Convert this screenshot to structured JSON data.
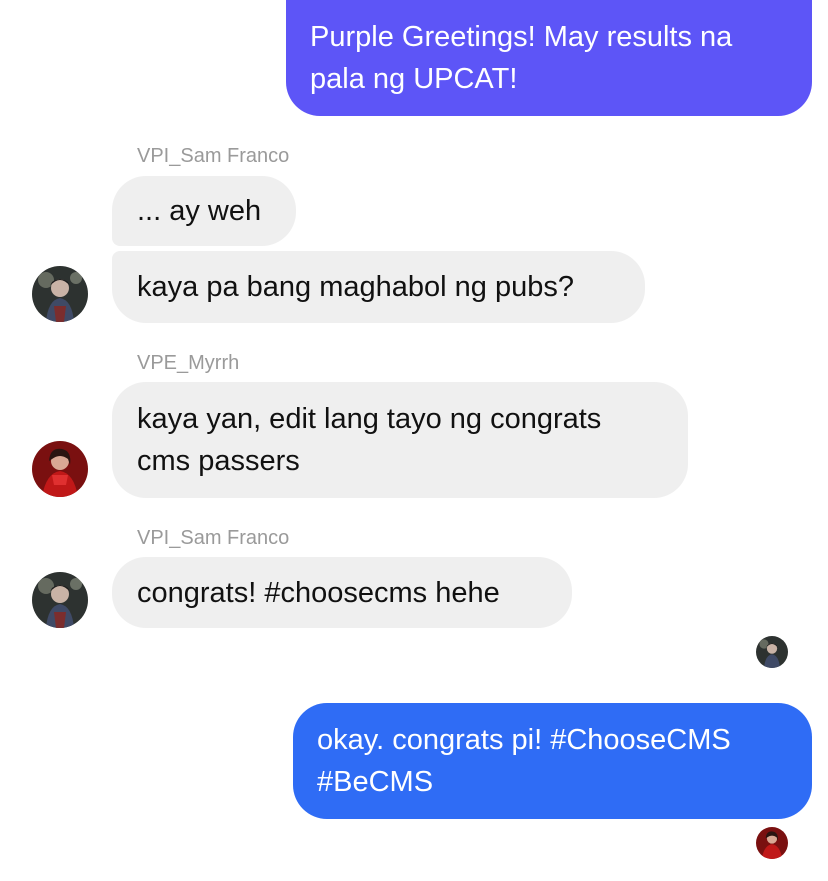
{
  "messages": {
    "out_1": "Purple Greetings! May results na\npala ng UPCAT!",
    "sender_1": "VPI_Sam Franco",
    "in_1a": "... ay weh",
    "in_1b": "kaya pa bang maghabol ng pubs?",
    "sender_2": "VPE_Myrrh",
    "in_2": "kaya yan, edit lang tayo ng congrats\ncms passers",
    "sender_3": "VPI_Sam Franco",
    "in_3": "congrats! #choosecms hehe",
    "out_2": "okay. congrats pi! #ChooseCMS\n#BeCMS"
  },
  "colors": {
    "bubble_purple": "#5d55f7",
    "bubble_blue": "#2f6cf5",
    "bubble_incoming": "#efefef",
    "sender_name": "#9a9a9a"
  },
  "icons": {
    "avatar_sam": "avatar-sam-franco-icon",
    "avatar_myrrh": "avatar-myrrh-icon"
  }
}
